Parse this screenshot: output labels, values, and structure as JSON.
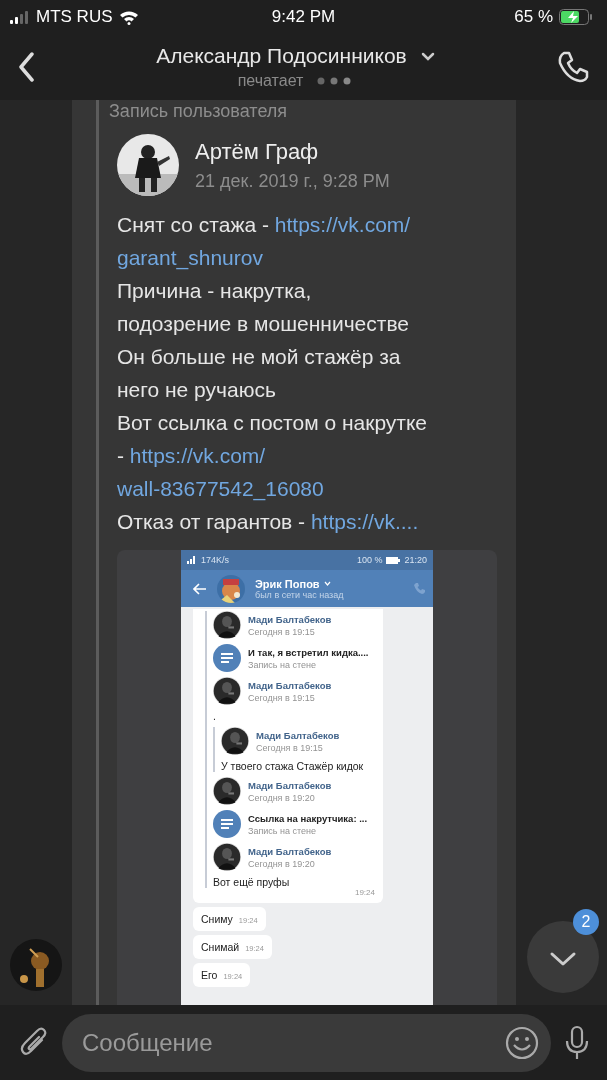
{
  "status_bar": {
    "carrier": "MTS RUS",
    "time": "9:42 PM",
    "battery": "65 %"
  },
  "header": {
    "title": "Александр Подосинников",
    "subtitle": "печатает"
  },
  "message": {
    "label": "Запись пользователя",
    "author": "Артём Граф",
    "date": "21 дек. 2019 г., 9:28 PM",
    "lines": [
      [
        {
          "kind": "text",
          "text": "Снят со стажа - "
        },
        {
          "kind": "link",
          "text": "https://vk.com/"
        }
      ],
      [
        {
          "kind": "link",
          "text": "garant_shnurov"
        }
      ],
      [
        {
          "kind": "text",
          "text": "Причина - накрутка,"
        }
      ],
      [
        {
          "kind": "text",
          "text": "подозрение в мошенничестве"
        }
      ],
      [
        {
          "kind": "text",
          "text": "Он больше не мой стажёр за"
        }
      ],
      [
        {
          "kind": "text",
          "text": "него не ручаюсь"
        }
      ],
      [
        {
          "kind": "text",
          "text": "Вот ссылка с постом о накрутке"
        }
      ],
      [
        {
          "kind": "text",
          "text": "- "
        },
        {
          "kind": "link",
          "text": "https://vk.com/"
        }
      ],
      [
        {
          "kind": "link",
          "text": "wall-83677542_16080"
        }
      ],
      [
        {
          "kind": "text",
          "text": "Отказ от гарантов - "
        },
        {
          "kind": "link",
          "text": "https://vk...."
        }
      ]
    ]
  },
  "screenshot": {
    "status": {
      "speed": "174K/s",
      "battery": "100 %",
      "time": "21:20"
    },
    "contact": {
      "name": "Эрик Попов",
      "status": "был в сети час назад"
    },
    "forward": {
      "items": [
        {
          "kind": "author",
          "name": "Мади Балтабеков",
          "time": "Сегодня в 19:15"
        },
        {
          "kind": "post",
          "title": "И так, я встретил кидка....",
          "subtitle": "Запись на стене"
        },
        {
          "kind": "author",
          "name": "Мади Балтабеков",
          "time": "Сегодня в 19:15"
        },
        {
          "kind": "text",
          "text": "."
        },
        {
          "kind": "quote",
          "items": [
            {
              "kind": "author",
              "name": "Мади Балтабеков",
              "time": "Сегодня в 19:15"
            },
            {
              "kind": "text",
              "text": "У твоего стажа Стажёр кидок"
            }
          ]
        },
        {
          "kind": "author",
          "name": "Мади Балтабеков",
          "time": "Сегодня в 19:20"
        },
        {
          "kind": "post",
          "title": "Ссылка на накрутчика: ...",
          "subtitle": "Запись на стене"
        },
        {
          "kind": "author",
          "name": "Мади Балтабеков",
          "time": "Сегодня в 19:20"
        },
        {
          "kind": "text",
          "text": "Вот ещё пруфы"
        }
      ],
      "time": "19:24"
    },
    "replies": [
      {
        "text": "Сниму",
        "time": "19:24"
      },
      {
        "text": "Снимай",
        "time": "19:24"
      },
      {
        "text": "Его",
        "time": "19:24"
      }
    ]
  },
  "scroll_button": {
    "badge": "2"
  },
  "composer": {
    "placeholder": "Сообщение"
  }
}
